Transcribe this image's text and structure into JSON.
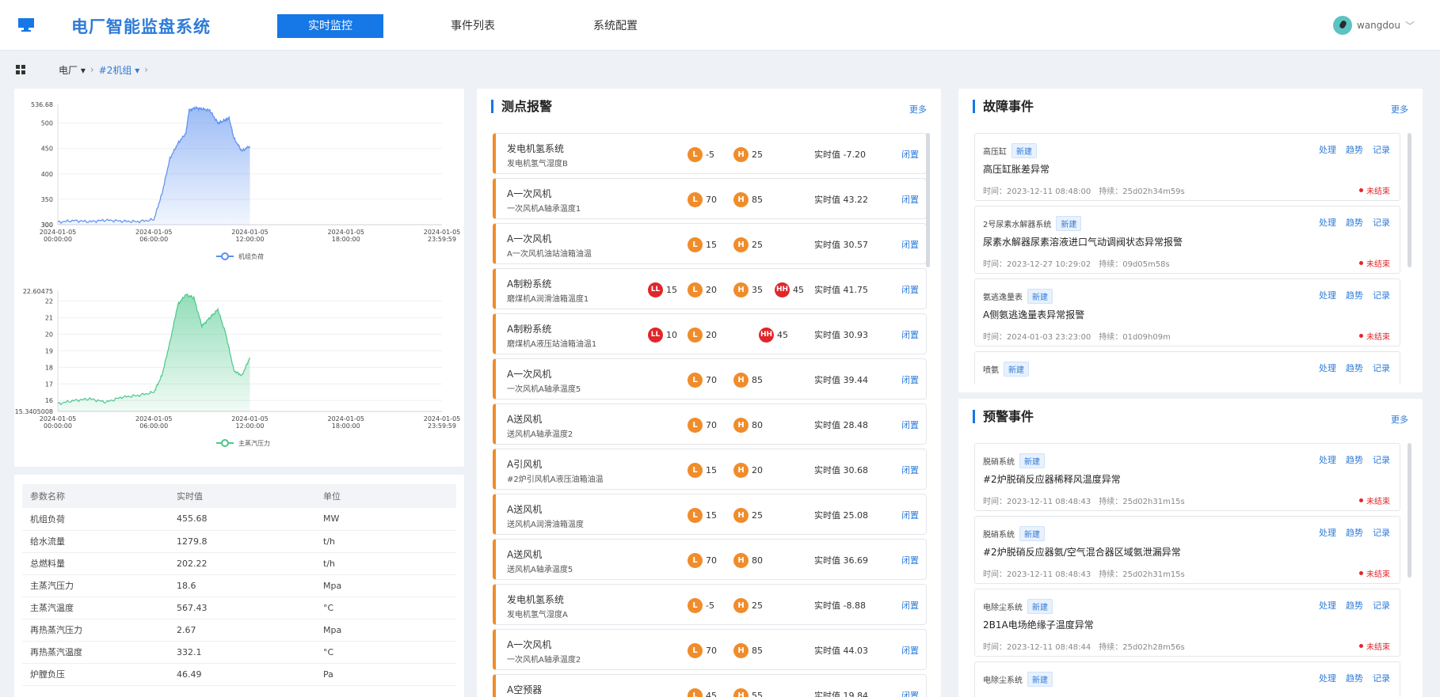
{
  "header": {
    "title": "电厂智能监盘系统",
    "tabs": [
      {
        "label": "实时监控",
        "active": true
      },
      {
        "label": "事件列表",
        "active": false
      },
      {
        "label": "系统配置",
        "active": false
      }
    ],
    "user": "wangdou"
  },
  "breadcrumb": {
    "plant": "电厂",
    "unit": "#2机组"
  },
  "chart_data": [
    {
      "type": "area",
      "series": [
        {
          "name": "机组负荷",
          "color": "#5b8ff0"
        }
      ],
      "ymin_label": "300",
      "ymax_label": "536.68",
      "yticks": [
        "300",
        "350",
        "400",
        "450",
        "500"
      ],
      "ylim": [
        300,
        536.68
      ],
      "xticks": [
        "2024-01-05 00:00:00",
        "2024-01-05 06:00:00",
        "2024-01-05 12:00:00",
        "2024-01-05 18:00:00",
        "2024-01-05 23:59:59"
      ],
      "x_hours": [
        0,
        1,
        2,
        3,
        4,
        5,
        6,
        6.5,
        7,
        7.5,
        8,
        8.2,
        8.6,
        9,
        9.5,
        10,
        10.4,
        10.7,
        11,
        11.5,
        12
      ],
      "values": [
        305,
        308,
        306,
        309,
        307,
        306,
        310,
        360,
        430,
        460,
        480,
        525,
        530,
        528,
        525,
        500,
        505,
        510,
        470,
        445,
        455
      ]
    },
    {
      "type": "area",
      "series": [
        {
          "name": "主蒸汽压力",
          "color": "#4cc88b"
        }
      ],
      "ymin_label": "15.3405008",
      "ymax_label": "22.60475",
      "yticks": [
        "16",
        "17",
        "18",
        "19",
        "20",
        "21",
        "22"
      ],
      "ylim": [
        15.3405008,
        22.60475
      ],
      "xticks": [
        "2024-01-05 00:00:00",
        "2024-01-05 06:00:00",
        "2024-01-05 12:00:00",
        "2024-01-05 18:00:00",
        "2024-01-05 23:59:59"
      ],
      "x_hours": [
        0,
        1,
        2,
        3,
        4,
        5,
        6,
        6.5,
        7,
        7.5,
        8,
        8.5,
        9,
        9.5,
        10,
        10.5,
        11,
        11.5,
        12
      ],
      "values": [
        15.8,
        16.0,
        16.1,
        15.9,
        16.2,
        16.3,
        16.5,
        17.5,
        19.5,
        21.8,
        22.4,
        22.2,
        20.5,
        21.0,
        21.5,
        20.0,
        17.8,
        17.5,
        18.6
      ]
    }
  ],
  "params": {
    "headers": [
      "参数名称",
      "实时值",
      "单位"
    ],
    "rows": [
      [
        "机组负荷",
        "455.68",
        "MW"
      ],
      [
        "给水流量",
        "1279.8",
        "t/h"
      ],
      [
        "总燃料量",
        "202.22",
        "t/h"
      ],
      [
        "主蒸汽压力",
        "18.6",
        "Mpa"
      ],
      [
        "主蒸汽温度",
        "567.43",
        "°C"
      ],
      [
        "再热蒸汽压力",
        "2.67",
        "Mpa"
      ],
      [
        "再热蒸汽温度",
        "332.1",
        "°C"
      ],
      [
        "炉膛负压",
        "46.49",
        "Pa"
      ]
    ]
  },
  "alarm": {
    "title": "测点报警",
    "more": "更多",
    "value_prefix": "实时值",
    "action": "闭置",
    "items": [
      {
        "system": "发电机氢系统",
        "point": "发电机氢气湿度B",
        "LL": null,
        "L": "-5",
        "H": "25",
        "HH": null,
        "value": "-7.20"
      },
      {
        "system": "A一次风机",
        "point": "一次风机A轴承温度1",
        "LL": null,
        "L": "70",
        "H": "85",
        "HH": null,
        "value": "43.22"
      },
      {
        "system": "A一次风机",
        "point": "A一次风机油站油箱油温",
        "LL": null,
        "L": "15",
        "H": "25",
        "HH": null,
        "value": "30.57"
      },
      {
        "system": "A制粉系统",
        "point": "磨煤机A润滑油箱温度1",
        "LL": "15",
        "L": "20",
        "H": "35",
        "HH": "45",
        "value": "41.75"
      },
      {
        "system": "A制粉系统",
        "point": "磨煤机A液压站油箱油温1",
        "LL": "10",
        "L": "20",
        "H": null,
        "HH": "45",
        "value": "30.93"
      },
      {
        "system": "A一次风机",
        "point": "一次风机A轴承温度5",
        "LL": null,
        "L": "70",
        "H": "85",
        "HH": null,
        "value": "39.44"
      },
      {
        "system": "A送风机",
        "point": "送风机A轴承温度2",
        "LL": null,
        "L": "70",
        "H": "80",
        "HH": null,
        "value": "28.48"
      },
      {
        "system": "A引风机",
        "point": "#2炉引风机A液压油箱油温",
        "LL": null,
        "L": "15",
        "H": "20",
        "HH": null,
        "value": "30.68"
      },
      {
        "system": "A送风机",
        "point": "送风机A润滑油箱温度",
        "LL": null,
        "L": "15",
        "H": "25",
        "HH": null,
        "value": "25.08"
      },
      {
        "system": "A送风机",
        "point": "送风机A轴承温度5",
        "LL": null,
        "L": "70",
        "H": "80",
        "HH": null,
        "value": "36.69"
      },
      {
        "system": "发电机氢系统",
        "point": "发电机氢气湿度A",
        "LL": null,
        "L": "-5",
        "H": "25",
        "HH": null,
        "value": "-8.88"
      },
      {
        "system": "A一次风机",
        "point": "一次风机A轴承温度2",
        "LL": null,
        "L": "70",
        "H": "85",
        "HH": null,
        "value": "44.03"
      },
      {
        "system": "A空预器",
        "point": "",
        "LL": null,
        "L": "45",
        "H": "55",
        "HH": null,
        "value": "19.84"
      }
    ]
  },
  "fault": {
    "title": "故障事件",
    "more": "更多",
    "items": [
      {
        "system": "高压缸",
        "tag": "新建",
        "name": "高压缸胀差异常",
        "time": "时间：2023-12-11 08:48:00",
        "duration": "持续：25d02h34m59s",
        "status": "未结束"
      },
      {
        "system": "2号尿素水解器系统",
        "tag": "新建",
        "name": "尿素水解器尿素溶液进口气动调阀状态异常报警",
        "time": "时间：2023-12-27 10:29:02",
        "duration": "持续：09d05m58s",
        "status": "未结束"
      },
      {
        "system": "氨逃逸量表",
        "tag": "新建",
        "name": "A侧氨逃逸量表异常报警",
        "time": "时间：2024-01-03 23:23:00",
        "duration": "持续：01d09h09m",
        "status": "未结束"
      },
      {
        "system": "喷氨",
        "tag": "新建",
        "name": "",
        "time": "",
        "duration": "",
        "status": ""
      }
    ],
    "actions": [
      "处理",
      "趋势",
      "记录"
    ]
  },
  "warning": {
    "title": "预警事件",
    "more": "更多",
    "items": [
      {
        "system": "脱硝系统",
        "tag": "新建",
        "name": "#2炉脱硝反应器稀释风温度异常",
        "time": "时间：2023-12-11 08:48:43",
        "duration": "持续：25d02h31m15s",
        "status": "未结束"
      },
      {
        "system": "脱硝系统",
        "tag": "新建",
        "name": "#2炉脱硝反应器氨/空气混合器区域氨泄漏异常",
        "time": "时间：2023-12-11 08:48:43",
        "duration": "持续：25d02h31m15s",
        "status": "未结束"
      },
      {
        "system": "电除尘系统",
        "tag": "新建",
        "name": "2B1A电场绝缘子温度异常",
        "time": "时间：2023-12-11 08:48:44",
        "duration": "持续：25d02h28m56s",
        "status": "未结束"
      },
      {
        "system": "电除尘系统",
        "tag": "新建",
        "name": "",
        "time": "",
        "duration": "",
        "status": ""
      }
    ],
    "actions": [
      "处理",
      "趋势",
      "记录"
    ]
  }
}
